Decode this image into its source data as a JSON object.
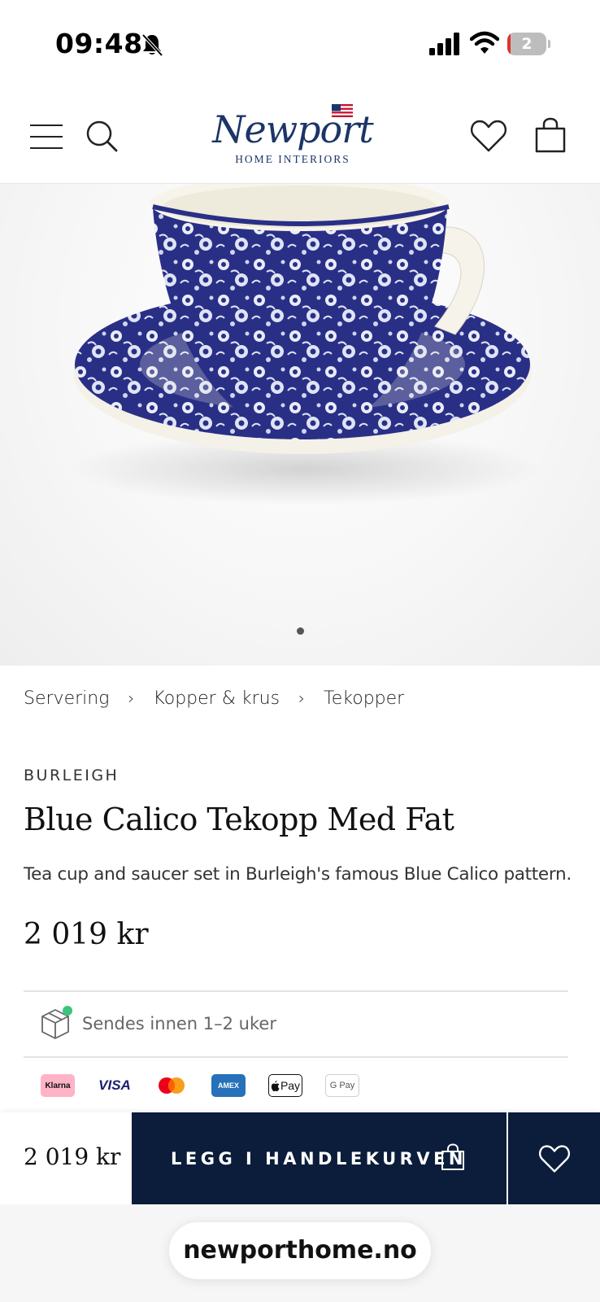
{
  "status_bar": {
    "time": "09:48",
    "battery_level": "2",
    "battery_fraction": 0.08
  },
  "header": {
    "logo_script": "Newport",
    "logo_subtitle": "HOME INTERIORS"
  },
  "hero": {
    "image_alt": "Blue Calico teacup and saucer",
    "carousel_count": 1,
    "carousel_active": 1
  },
  "breadcrumb": {
    "items": [
      "Servering",
      "Kopper & krus",
      "Tekopper"
    ],
    "separator": "›"
  },
  "product": {
    "brand": "BURLEIGH",
    "title": "Blue Calico Tekopp Med Fat",
    "description": "Tea cup and saucer set in Burleigh's famous Blue Calico pattern.",
    "price": "2 019 kr",
    "shipping": "Sendes innen 1–2 uker"
  },
  "payments": {
    "klarna": "Klarna",
    "visa": "VISA",
    "amex": "AMEX",
    "apple_pay": "Pay",
    "google_pay": "G Pay"
  },
  "bottom_bar": {
    "price": "2 019 kr",
    "add_to_cart": "LEGG I HANDLEKURVEN"
  },
  "browser": {
    "url": "newporthome.no"
  },
  "colors": {
    "navy": "#0b1d3a",
    "logo_blue": "#1c3567",
    "porcelain_blue": "#2a2f86",
    "stock_green": "#3cc47c"
  }
}
